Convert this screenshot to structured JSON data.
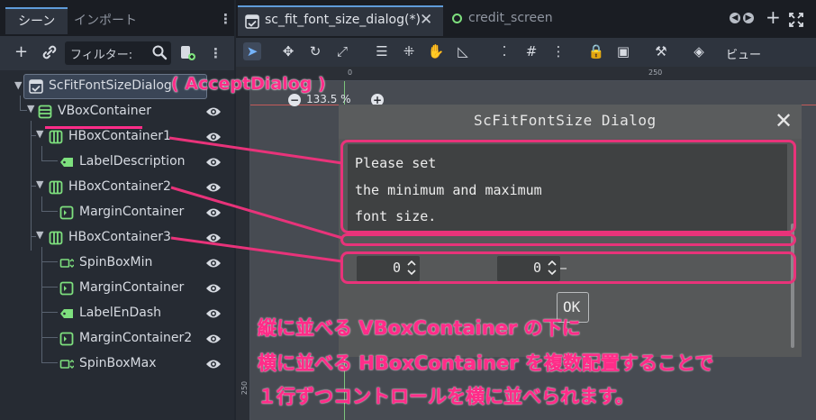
{
  "dock": {
    "tab_scene": "シーン",
    "tab_import": "インポート",
    "filter_placeholder": "フィルター:",
    "tree": [
      {
        "label": "ScFitFontSizeDialog",
        "icon": "accept-dialog-icon"
      },
      {
        "label": "VBoxContainer",
        "icon": "vbox-icon"
      },
      {
        "label": "HBoxContainer1",
        "icon": "hbox-icon"
      },
      {
        "label": "LabelDescription",
        "icon": "label-icon"
      },
      {
        "label": "HBoxContainer2",
        "icon": "hbox-icon"
      },
      {
        "label": "MarginContainer",
        "icon": "margin-container-icon"
      },
      {
        "label": "HBoxContainer3",
        "icon": "hbox-icon"
      },
      {
        "label": "SpinBoxMin",
        "icon": "spinbox-icon"
      },
      {
        "label": "MarginContainer",
        "icon": "margin-container-icon"
      },
      {
        "label": "LabelEnDash",
        "icon": "label-icon"
      },
      {
        "label": "MarginContainer2",
        "icon": "margin-container-icon"
      },
      {
        "label": "SpinBoxMax",
        "icon": "spinbox-icon"
      }
    ]
  },
  "editor": {
    "tab_active": "sc_fit_font_size_dialog(*)",
    "tab_other": "credit_screen",
    "view_menu": "ビュー",
    "zoom": "133.5 %",
    "ruler_top_mark": "250",
    "ruler_left_mark": "250"
  },
  "dialog": {
    "title": "ScFitFontSize Dialog",
    "description_lines": [
      "Please set",
      "the minimum and maximum",
      "font size."
    ],
    "spin_min_value": "0",
    "spin_max_value": "0",
    "en_dash": "—",
    "ok_label": "OK"
  },
  "annotations": {
    "accept_dialog": "( AcceptDialog )",
    "line1": "縦に並べる VBoxContainer の下に",
    "line2": "横に並べる HBoxContainer を複数配置することで",
    "line3": "１行ずつコントロールを横に並べられます。",
    "color": "#ff2d89"
  },
  "colors": {
    "accent": "#5f9bd9",
    "icon_green": "#7ee07e",
    "selection": "#3a4556"
  }
}
